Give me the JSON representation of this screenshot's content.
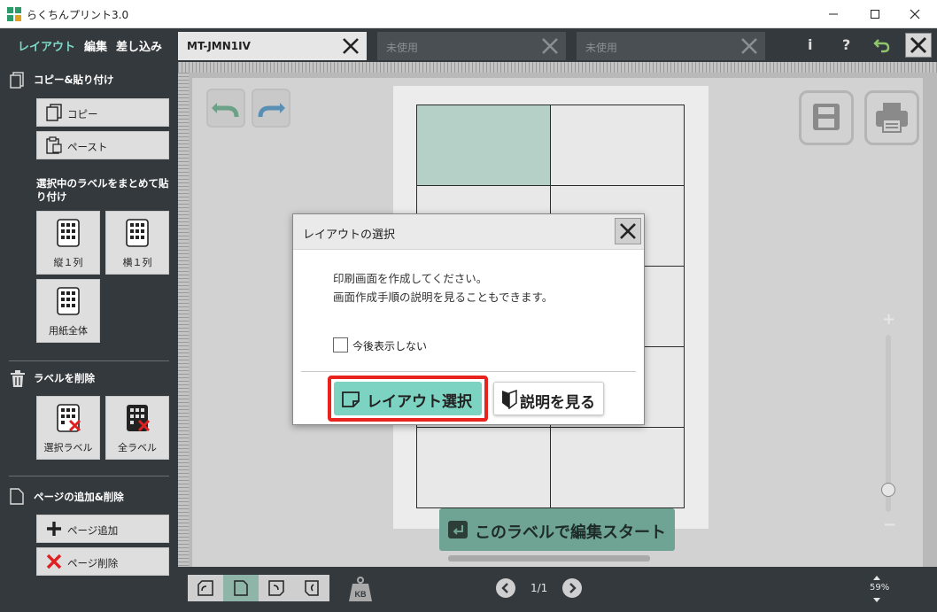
{
  "window": {
    "title": "らくちんプリント3.0"
  },
  "top_modes": [
    "レイアウト",
    "編集",
    "差し込み"
  ],
  "doc_tabs": [
    {
      "label": "MT-JMN1IV"
    },
    {
      "label": "未使用"
    },
    {
      "label": "未使用"
    }
  ],
  "top_icons": {
    "info": "i",
    "help": "?"
  },
  "sidebar": {
    "copy_paste_title": "コピー&貼り付け",
    "copy_label": "コピー",
    "paste_label": "ペースト",
    "batch_paste_note": "選択中のラベルをまとめて貼り付け",
    "tile_vertical": "縦１列",
    "tile_horizontal": "横１列",
    "tile_whole": "用紙全体",
    "delete_title": "ラベルを削除",
    "tile_delete_selected": "選択ラベル",
    "tile_delete_all": "全ラベル",
    "page_title": "ページの追加&削除",
    "add_page_label": "ページ追加",
    "delete_page_label": "ページ削除"
  },
  "canvas": {
    "start_button": "このラベルで編集スタート",
    "zoom_plus": "+",
    "zoom_minus": "−",
    "zoom_level": 0.1
  },
  "bottom": {
    "page_indicator": "1/1",
    "zoom_percent": "59%",
    "kb_label": "KB"
  },
  "modal": {
    "title": "レイアウトの選択",
    "message_line1": "印刷画面を作成してください。",
    "message_line2": "画面作成手順の説明を見ることもできます。",
    "checkbox_label": "今後表示しない",
    "checkbox_checked": false,
    "layout_button": "レイアウト選択",
    "help_button": "説明を見る"
  },
  "colors": {
    "accent": "#7dd3c1",
    "dark_panel": "#34393d",
    "highlight_border": "#e8221c"
  }
}
